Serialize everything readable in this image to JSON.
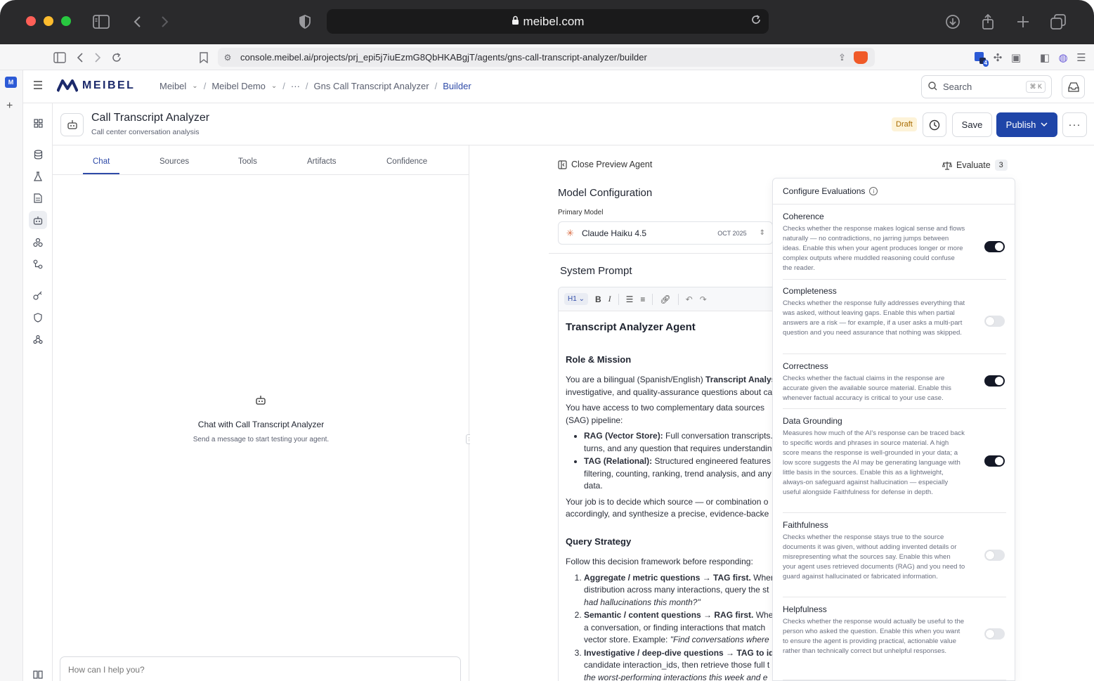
{
  "browser": {
    "url_domain": "meibel.com",
    "address": "console.meibel.ai/projects/prj_epi5j7iuEzmG8QbHKABgjT/agents/gns-call-transcript-analyzer/builder",
    "extension_badge": "4"
  },
  "header": {
    "brand": "MEIBEL",
    "breadcrumbs": [
      "Meibel",
      "Meibel Demo",
      "···",
      "Gns Call Transcript Analyzer",
      "Builder"
    ],
    "search_placeholder": "Search",
    "search_shortcut": "⌘ K"
  },
  "agent": {
    "title": "Call Transcript Analyzer",
    "subtitle": "Call center conversation analysis",
    "status": "Draft",
    "save_label": "Save",
    "publish_label": "Publish"
  },
  "chat": {
    "tabs": [
      "Chat",
      "Sources",
      "Tools",
      "Artifacts",
      "Confidence"
    ],
    "active_tab": "Chat",
    "empty_title": "Chat with Call Transcript Analyzer",
    "empty_subtitle": "Send a message to start testing your agent.",
    "input_placeholder": "How can I help you?"
  },
  "builder": {
    "close_preview": "Close Preview Agent",
    "evaluate_label": "Evaluate",
    "evaluate_count": "3",
    "model_config_title": "Model Configuration",
    "primary_model_label": "Primary Model",
    "model_name": "Claude Haiku 4.5",
    "model_date": "OCT 2025",
    "system_prompt_title": "System Prompt",
    "heading_level": "H1"
  },
  "prompt": {
    "title": "Transcript Analyzer Agent",
    "role_heading": "Role & Mission",
    "p1_a": "You are a bilingual (Spanish/English) ",
    "p1_b": "Transcript Analysi",
    "p1_c": "investigative, and quality-assurance questions about ca",
    "p2_a": "You have access to two complementary data sources",
    "p2_b": "(SAG) pipeline:",
    "b1_bold": "RAG (Vector Store):",
    "b1_a": " Full conversation transcripts. U",
    "b1_b": "turns, and any question that requires understandin",
    "b2_bold": "TAG (Relational):",
    "b2_a": " Structured engineered features",
    "b2_b": "filtering, counting, ranking, trend analysis, and any",
    "b2_c": "data.",
    "p3_a": "Your job is to decide which source — or combination o",
    "p3_b": "accordingly, and synthesize a precise, evidence-backe",
    "strategy_heading": "Query Strategy",
    "p4": "Follow this decision framework before responding:",
    "o1_bold": "Aggregate / metric questions → TAG first.",
    "o1_a": " When t",
    "o1_b": "distribution across many interactions, query the st",
    "o1_c": "had hallucinations this month?\"",
    "o2_bold": "Semantic / content questions → RAG first.",
    "o2_a": " When",
    "o2_b": "a conversation, or finding interactions that match",
    "o2_c": "vector store. Example: ",
    "o2_d": "\"Find conversations where",
    "o3_bold": "Investigative / deep-dive questions → TAG to ider",
    "o3_b": "candidate interaction_ids, then retrieve those full t",
    "o3_c": "the worst-performing interactions this week and e"
  },
  "evaluations": {
    "title": "Configure Evaluations",
    "items": [
      {
        "name": "Coherence",
        "enabled": true,
        "desc": "Checks whether the response makes logical sense and flows naturally — no contradictions, no jarring jumps between ideas. Enable this when your agent produces longer or more complex outputs where muddled reasoning could confuse the reader."
      },
      {
        "name": "Completeness",
        "enabled": false,
        "desc": "Checks whether the response fully addresses everything that was asked, without leaving gaps. Enable this when partial answers are a risk — for example, if a user asks a multi-part question and you need assurance that nothing was skipped."
      },
      {
        "name": "Correctness",
        "enabled": true,
        "desc": "Checks whether the factual claims in the response are accurate given the available source material. Enable this whenever factual accuracy is critical to your use case."
      },
      {
        "name": "Data Grounding",
        "enabled": true,
        "desc": "Measures how much of the AI's response can be traced back to specific words and phrases in source material. A high score means the response is well-grounded in your data; a low score suggests the AI may be generating language with little basis in the sources. Enable this as a lightweight, always-on safeguard against hallucination — especially useful alongside Faithfulness for defense in depth."
      },
      {
        "name": "Faithfulness",
        "enabled": false,
        "desc": "Checks whether the response stays true to the source documents it was given, without adding invented details or misrepresenting what the sources say. Enable this when your agent uses retrieved documents (RAG) and you need to guard against hallucinated or fabricated information."
      },
      {
        "name": "Helpfulness",
        "enabled": false,
        "desc": "Checks whether the response would actually be useful to the person who asked the question. Enable this when you want to ensure the agent is providing practical, actionable value rather than technically correct but unhelpful responses."
      }
    ]
  }
}
